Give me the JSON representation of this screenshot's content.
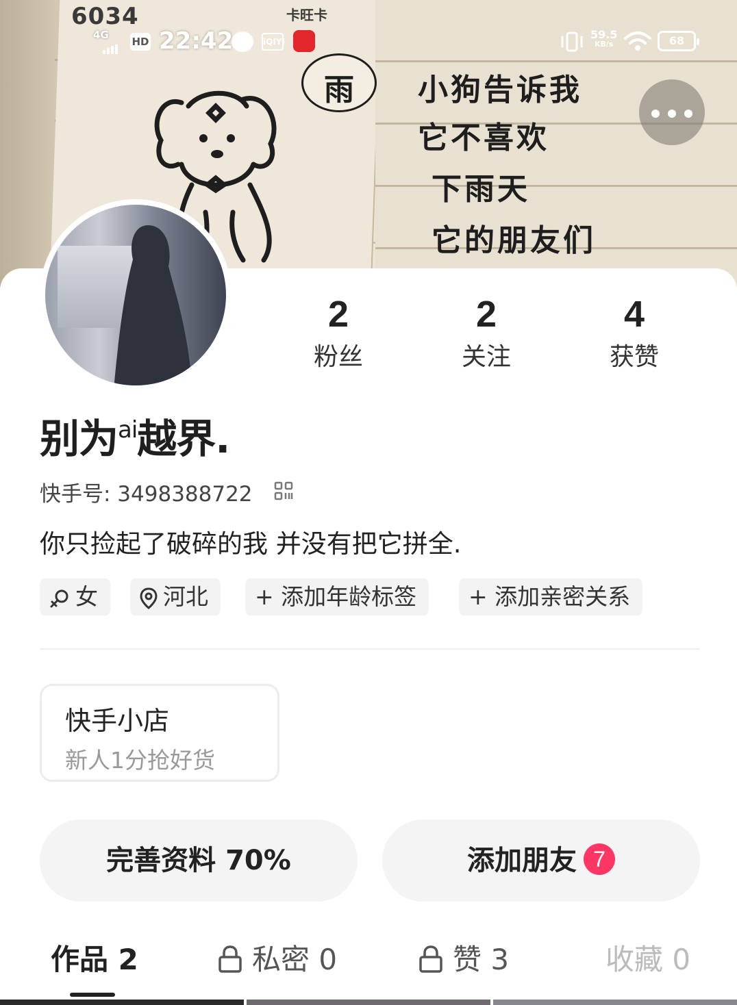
{
  "cover": {
    "number": "6034",
    "brand": "卡旺卡",
    "bubble_text": "雨",
    "handwriting": [
      "小狗告诉我",
      "它不喜欢",
      "下雨天",
      "它的朋友们"
    ]
  },
  "status_bar": {
    "network": "4G",
    "hd": "HD",
    "time": "22:42",
    "app2": "iQIYI",
    "speed_value": "59.5",
    "speed_unit": "KB/s",
    "battery": "68",
    "icons": [
      "signal-icon",
      "hd-icon",
      "app-icon",
      "iqiyi-icon",
      "app-icon",
      "vibrate-icon",
      "wifi-icon",
      "battery-icon"
    ]
  },
  "header": {
    "more_icon": "more-dots-icon"
  },
  "profile": {
    "stats": [
      {
        "num": "2",
        "label": "粉丝"
      },
      {
        "num": "2",
        "label": "关注"
      },
      {
        "num": "4",
        "label": "获赞"
      }
    ],
    "nickname_a": "别为",
    "nickname_sup": "ai",
    "nickname_b": "越界.",
    "uid": "快手号: 3498388722",
    "bio": "你只捡起了破碎的我 并没有把它拼全.",
    "tags": [
      "女",
      "河北",
      "+ 添加年龄标签",
      "+ 添加亲密关系"
    ]
  },
  "shop": {
    "title": "快手小店",
    "subtitle": "新人1分抢好货"
  },
  "actions": {
    "complete_profile": "完善资料 70%",
    "complete_percent": 70,
    "add_friends": "添加朋友",
    "add_friends_badge": "7",
    "badge_color": "#fe3666"
  },
  "tabs": [
    {
      "label": "作品 2"
    },
    {
      "label": "私密 0"
    },
    {
      "label": "赞 3"
    },
    {
      "label": "收藏 0"
    }
  ]
}
